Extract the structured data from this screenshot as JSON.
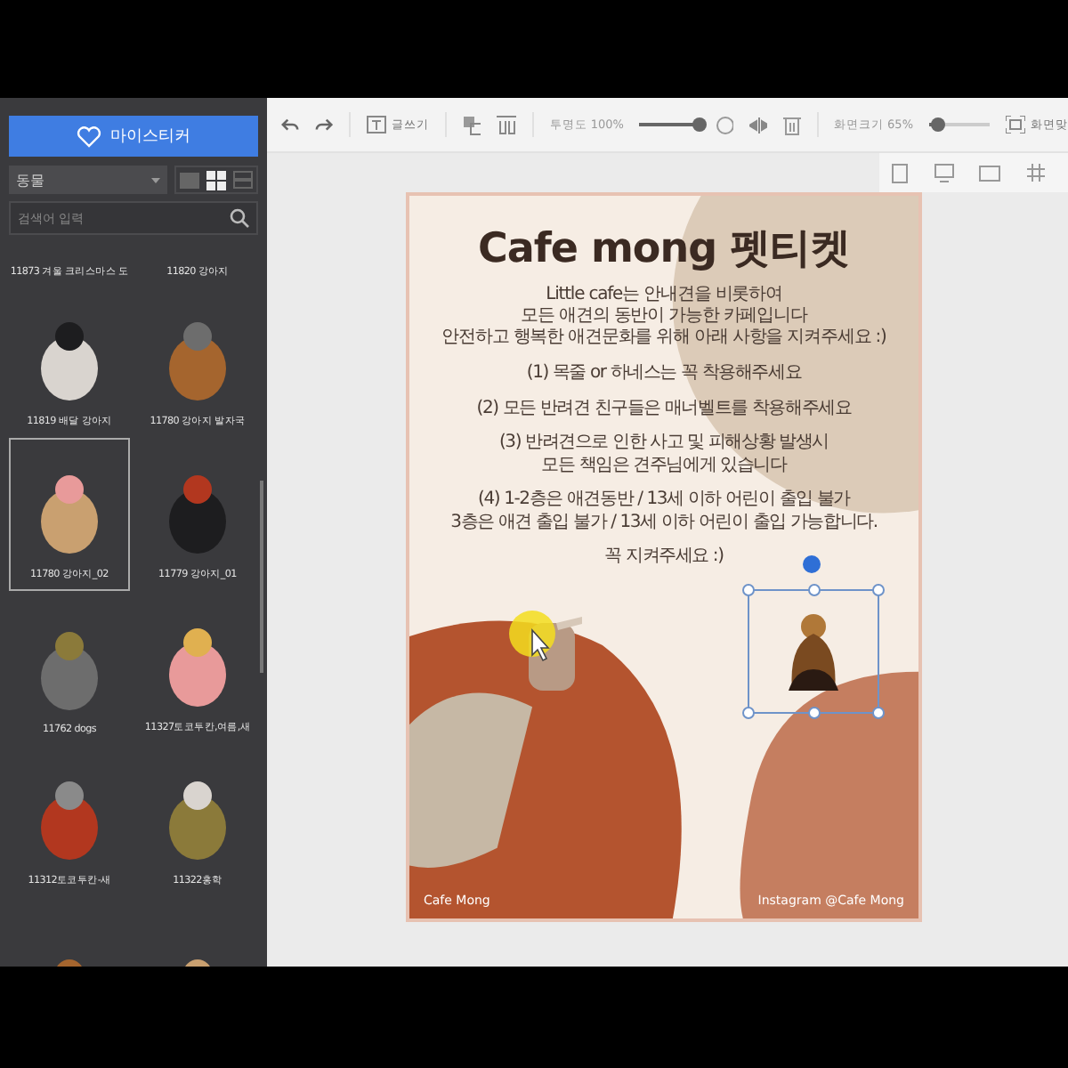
{
  "sidebar": {
    "sticker_button": "마이스티커",
    "category": "동물",
    "view_modes": [
      {
        "kind": "list",
        "selected": false
      },
      {
        "kind": "grid",
        "selected": true
      },
      {
        "kind": "rows",
        "selected": false
      }
    ],
    "search": {
      "placeholder": "검색어 입력"
    },
    "stickers": [
      {
        "kind": "label_only",
        "label": "11873 겨울 크리스마스 도",
        "selected": false
      },
      {
        "kind": "label_only",
        "label": "11820 강아지",
        "selected": false
      },
      {
        "kind": "sticker",
        "label": "11819 배달 강아지",
        "selected": false
      },
      {
        "kind": "sticker",
        "label": "11780 강아지 발자국",
        "selected": false
      },
      {
        "kind": "sticker",
        "label": "11780 강아지_02",
        "selected": true
      },
      {
        "kind": "sticker",
        "label": "11779 강아지_01",
        "selected": false
      },
      {
        "kind": "sticker",
        "label": "11762 dogs",
        "selected": false
      },
      {
        "kind": "sticker",
        "label": "11327토코투칸,여름,새",
        "selected": false
      },
      {
        "kind": "sticker",
        "label": "11312토코투칸-새",
        "selected": false
      },
      {
        "kind": "sticker",
        "label": "11322홍학",
        "selected": false
      },
      {
        "kind": "sticker",
        "selected": false
      },
      {
        "kind": "sticker",
        "selected": false
      }
    ]
  },
  "toolbar": {
    "write_label": "글쓰기",
    "opacity": {
      "label": "투명도 100%",
      "level": 1
    },
    "zoom": {
      "label": "화면크기 65%",
      "level": 0.15
    },
    "fit_label": "화면맞"
  },
  "poster": {
    "title": "Cafe mong 펫티켓",
    "intro": "Little cafe는 안내견을 비롯하여\n모든 애견의 동반이 가능한 카페입니다\n안전하고 행복한 애견문화를 위해 아래 사항을 지켜주세요 :)",
    "rules": [
      "(1) 목줄 or 하네스는 꼭 착용해주세요",
      "(2) 모든 반려견 친구들은 매너벨트를 착용해주세요",
      "(3) 반려견으로 인한 사고 및 피해상황 발생시\n모든 책임은 견주님에게 있습니다",
      "(4) 1-2층은 애견동반 / 13세 이하 어린이 출입 불가\n3층은 애견 출입 불가 / 13세 이하 어린이 출입 가능합니다."
    ],
    "closing": "꼭 지켜주세요 :)",
    "footer_left": "Cafe Mong",
    "footer_right": "Instagram @Cafe Mong"
  }
}
